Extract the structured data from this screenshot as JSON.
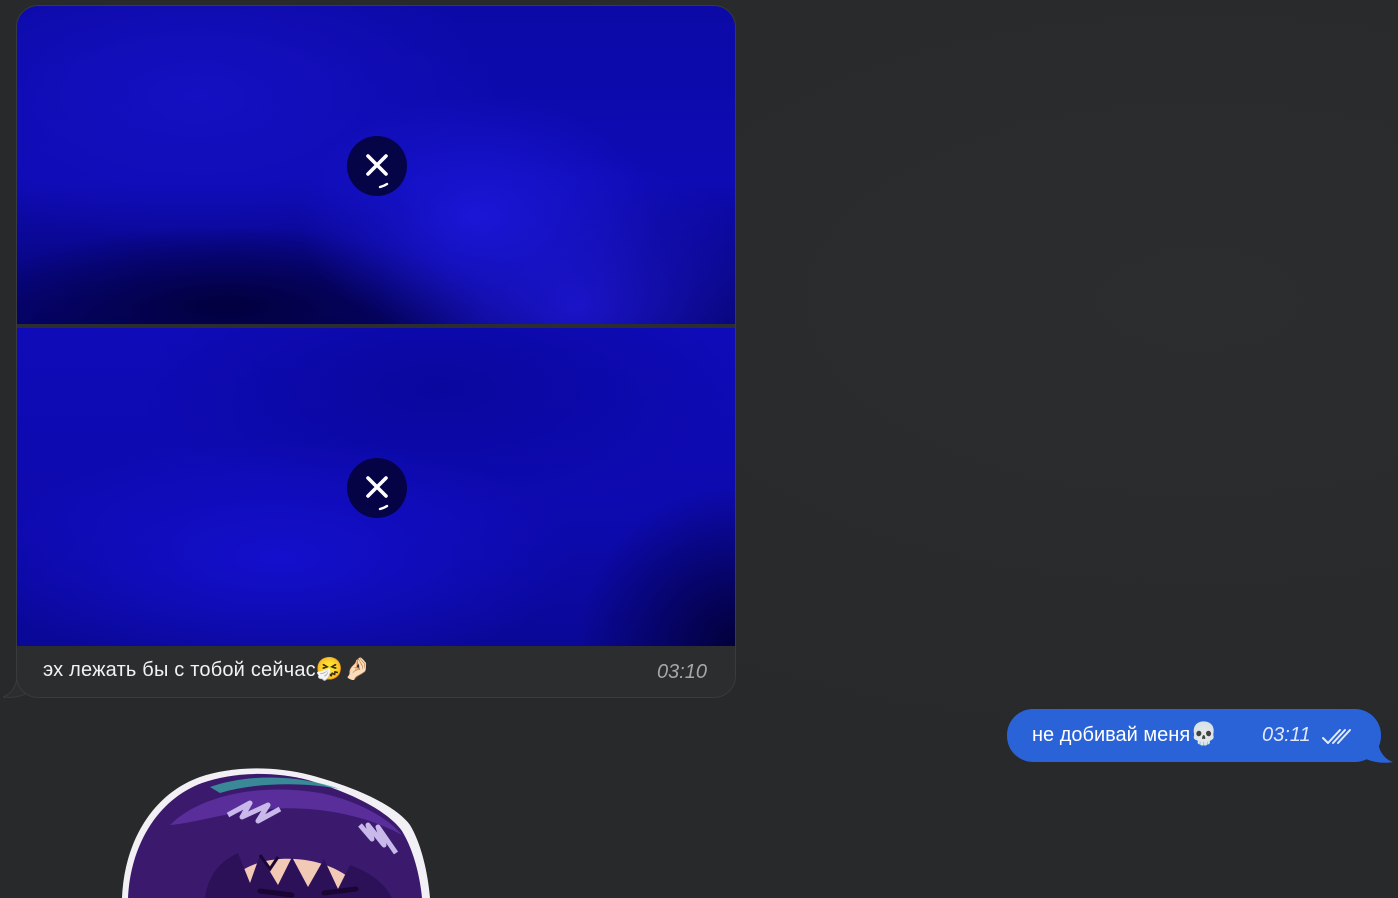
{
  "incoming": {
    "caption": "эх лежать бы с тобой сейчас",
    "caption_emoji": "🤧🤌🏻",
    "time": "03:10",
    "media": [
      {
        "type": "photo",
        "state": "not-downloaded",
        "button_icon": "close-icon"
      },
      {
        "type": "photo",
        "state": "not-downloaded",
        "button_icon": "close-icon"
      }
    ]
  },
  "outgoing": {
    "text": "не добивай меня",
    "emoji": "💀",
    "time": "03:11",
    "status_icon": "double-check-icon"
  },
  "sticker": {
    "description_icon": "anime-girl-sticker"
  },
  "colors": {
    "background": "#27292b",
    "incoming_bubble": "#2c2d2f",
    "outgoing_bubble": "#2a62d8",
    "media_blue": "#0e0bb4"
  }
}
